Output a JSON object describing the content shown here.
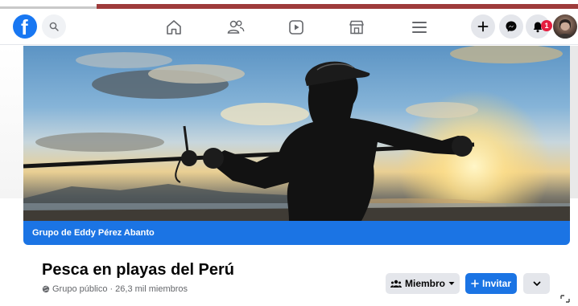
{
  "navbar": {
    "logo_letter": "f",
    "notification_count": "1",
    "icons": [
      "facebook-logo",
      "search-icon",
      "home-icon",
      "friends-icon",
      "watch-icon",
      "marketplace-icon",
      "menu-icon",
      "create-icon",
      "messenger-icon",
      "notifications-icon",
      "profile-avatar"
    ]
  },
  "group": {
    "owner_label": "Grupo de Eddy Pérez Abanto",
    "name": "Pesca en playas del Perú",
    "privacy": "Grupo público",
    "separator": "·",
    "members": "26,3 mil miembros"
  },
  "actions": {
    "member_label": "Miembro",
    "invite_label": "Invitar"
  },
  "colors": {
    "brand_blue": "#1877f2",
    "strip_blue": "#1b74e4",
    "badge_red": "#e41e3f",
    "button_gray": "#e4e6eb"
  }
}
